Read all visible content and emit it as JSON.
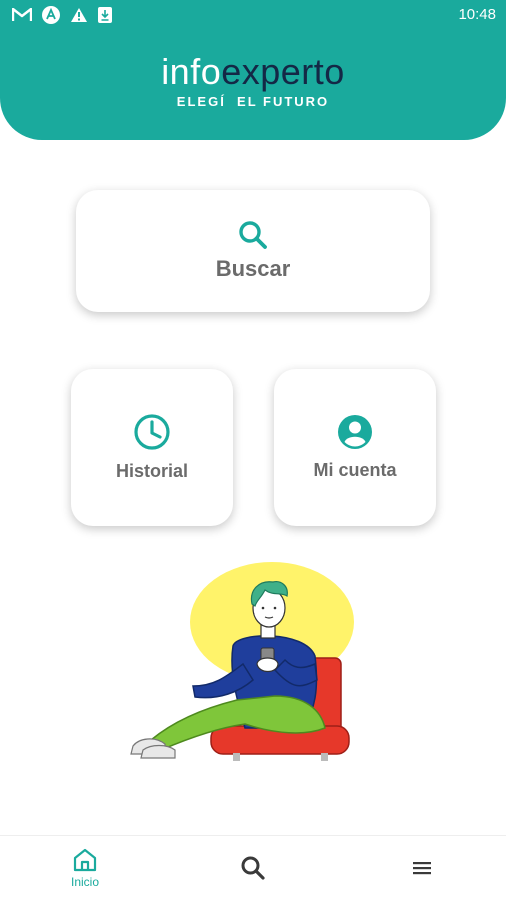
{
  "status_bar": {
    "time": "10:48",
    "icons": [
      "gmail-icon",
      "app-a-icon",
      "warning-icon",
      "download-icon"
    ]
  },
  "header": {
    "brand_info": "info",
    "brand_experto": "experto",
    "tagline": "ELEGÍ  EL FUTURO"
  },
  "main": {
    "buscar_label": "Buscar",
    "historial_label": "Historial",
    "cuenta_label": "Mi cuenta"
  },
  "bottom_nav": {
    "inicio_label": "Inicio",
    "active": "inicio"
  },
  "colors": {
    "primary": "#1aaa9d",
    "brand_dark": "#142846",
    "text_gray": "#6b6b6b"
  }
}
